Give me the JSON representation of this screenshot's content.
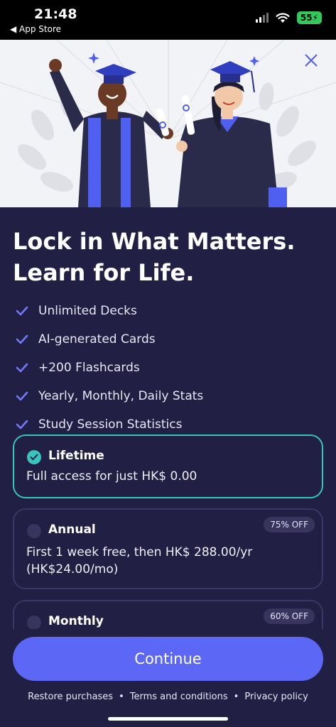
{
  "status_bar": {
    "time": "21:48",
    "back_label": "◀ App Store",
    "battery": "55"
  },
  "headline": {
    "line1": "Lock in What Matters.",
    "line2": "Learn for Life."
  },
  "features": [
    {
      "label": "Unlimited Decks"
    },
    {
      "label": "AI-generated Cards"
    },
    {
      "label": "+200 Flashcards"
    },
    {
      "label": "Yearly, Monthly, Daily Stats"
    },
    {
      "label": "Study Session Statistics"
    }
  ],
  "plans": {
    "lifetime": {
      "name": "Lifetime",
      "desc": "Full access for just HK$ 0.00",
      "selected": true
    },
    "annual": {
      "name": "Annual",
      "desc_line1": "First 1 week free, then HK$ 288.00/yr",
      "desc_line2": "(HK$24.00/mo)",
      "badge": "75% OFF"
    },
    "monthly": {
      "name": "Monthly",
      "badge": "60% OFF"
    }
  },
  "continue_label": "Continue",
  "links": {
    "restore": "Restore purchases",
    "terms": "Terms and conditions",
    "privacy": "Privacy policy",
    "separator": "•"
  },
  "colors": {
    "background": "#221f45",
    "accent": "#5c68f5",
    "selected_border": "#39c5bd",
    "check": "#6f7cf6"
  },
  "icons": {
    "close": "close-icon",
    "check": "check-icon",
    "wifi": "wifi-icon",
    "signal": "signal-icon",
    "battery": "battery-icon"
  }
}
